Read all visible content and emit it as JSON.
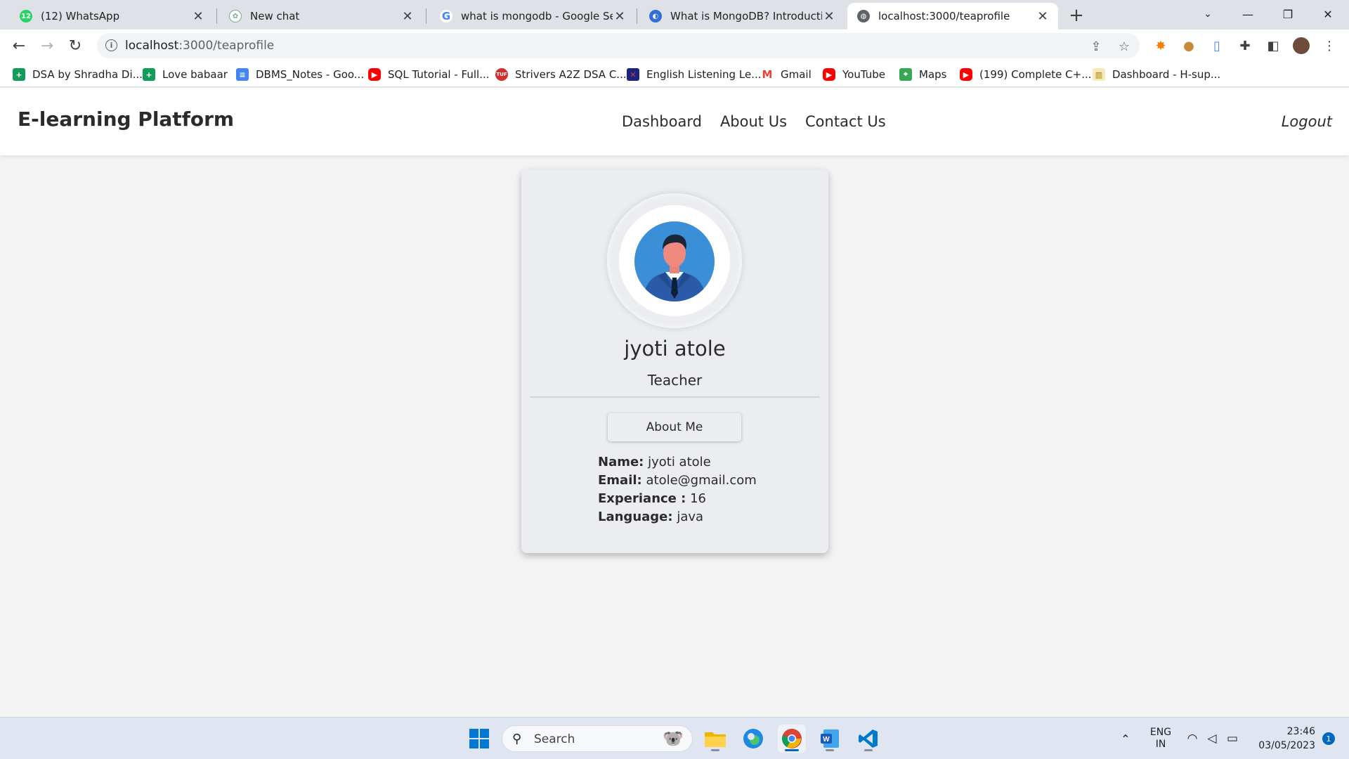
{
  "browser": {
    "tabs": [
      {
        "title": "(12) WhatsApp",
        "icon": "whatsapp-icon",
        "badge": "12",
        "active": false
      },
      {
        "title": "New chat",
        "icon": "chatgpt-icon",
        "active": false
      },
      {
        "title": "what is mongodb - Google Searc",
        "icon": "google-icon",
        "active": false
      },
      {
        "title": "What is MongoDB? Introduction,",
        "icon": "mongodb-site-icon",
        "active": false
      },
      {
        "title": "localhost:3000/teaprofile",
        "icon": "globe-icon",
        "active": true
      }
    ],
    "url_host": "localhost",
    "url_path": ":3000/teaprofile",
    "bookmarks": [
      {
        "label": "DSA by Shradha Di...",
        "icon": "sheets-icon",
        "color": "#0f9d58"
      },
      {
        "label": "Love babaar",
        "icon": "sheets-icon",
        "color": "#0f9d58"
      },
      {
        "label": "DBMS_Notes - Goo...",
        "icon": "docs-icon",
        "color": "#4285f4"
      },
      {
        "label": "SQL Tutorial - Full...",
        "icon": "youtube-icon",
        "color": "#ff0000"
      },
      {
        "label": "Strivers A2Z DSA C...",
        "icon": "tuf-icon",
        "color": "#d32f2f"
      },
      {
        "label": "English Listening Le...",
        "icon": "uk-flag-icon",
        "color": "#1a237e"
      },
      {
        "label": "Gmail",
        "icon": "gmail-icon",
        "color": "#ea4335"
      },
      {
        "label": "YouTube",
        "icon": "youtube-icon",
        "color": "#ff0000"
      },
      {
        "label": "Maps",
        "icon": "maps-icon",
        "color": "#34a853"
      },
      {
        "label": "(199) Complete C+...",
        "icon": "youtube-icon",
        "color": "#ff0000"
      },
      {
        "label": "Dashboard - H-sup...",
        "icon": "dashboard-icon",
        "color": "#f4b400"
      }
    ]
  },
  "site": {
    "brand": "E-learning Platform",
    "nav": {
      "dashboard": "Dashboard",
      "about": "About Us",
      "contact": "Contact Us"
    },
    "logout": "Logout"
  },
  "profile": {
    "name": "jyoti atole",
    "role": "Teacher",
    "about_button": "About Me",
    "details": [
      {
        "label": "Name:",
        "value": "jyoti atole"
      },
      {
        "label": "Email:",
        "value": "atole@gmail.com"
      },
      {
        "label": "Experiance :",
        "value": "16"
      },
      {
        "label": "Language:",
        "value": "java"
      }
    ]
  },
  "taskbar": {
    "search_placeholder": "Search",
    "lang_line1": "ENG",
    "lang_line2": "IN",
    "time": "23:46",
    "date": "03/05/2023",
    "notification_count": "1"
  },
  "colors": {
    "page_bg": "#f3f3f3",
    "card_bg": "#ebedf0",
    "avatar_blue": "#3a8fd6",
    "text_dark": "#2b2b2b"
  }
}
